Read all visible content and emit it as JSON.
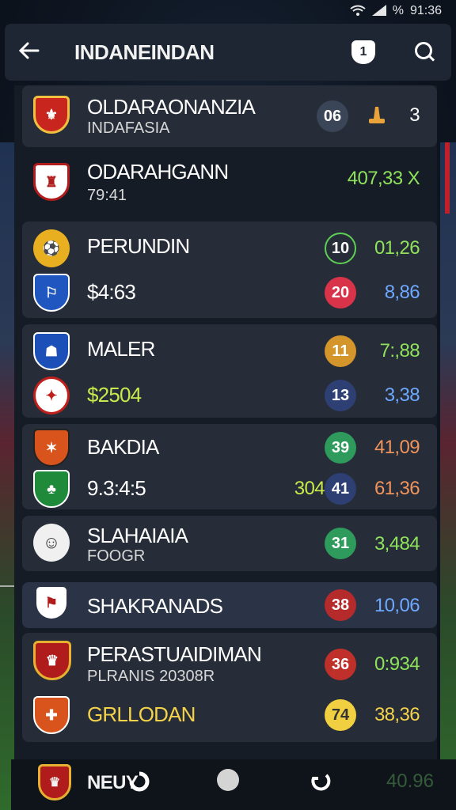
{
  "status": {
    "wifi": "wifi-icon",
    "signal": "signal-icon",
    "battery_text": "%",
    "time": "91:36"
  },
  "appbar": {
    "title": "INDANEINDAN",
    "badge_text": "1"
  },
  "rows": [
    {
      "name": "OLDARAONANZIA",
      "sub": "INDAFASIA",
      "pill": "06",
      "pill_color": "#3a4558",
      "right_icon": "flag-icon",
      "value": "3"
    },
    {
      "name": "ODARAHGANN",
      "sub": "79:41",
      "value": "407,33 X"
    },
    {
      "name": "PERUNDIN",
      "pill": "10",
      "value": "01,26"
    },
    {
      "name": "$4:63",
      "pill": "20",
      "value": "8,86"
    },
    {
      "name": "MALER",
      "pill": "11",
      "value": "7:,88"
    },
    {
      "name": "$2504",
      "pill": "13",
      "value": "3,38"
    },
    {
      "name": "BAKDIA",
      "pill": "39",
      "value": "41,09"
    },
    {
      "name": "9.3:4:5",
      "pill": "41",
      "extra": "304",
      "value": "61,36"
    },
    {
      "name": "SLAHAIAIA",
      "sub": "FOOGR",
      "pill": "31",
      "value": "3,484"
    },
    {
      "name": "SHAKRANADS",
      "pill": "38",
      "value": "10,06"
    },
    {
      "name": "PERASTUAIDIMAN",
      "sub": "PLRANIS 20308R",
      "pill": "36",
      "value": "0:934"
    },
    {
      "name": "GRLLODAN",
      "pill": "74",
      "value": "38,36"
    }
  ],
  "bottomnav": {
    "label": "NEUY",
    "value": "40.96"
  }
}
